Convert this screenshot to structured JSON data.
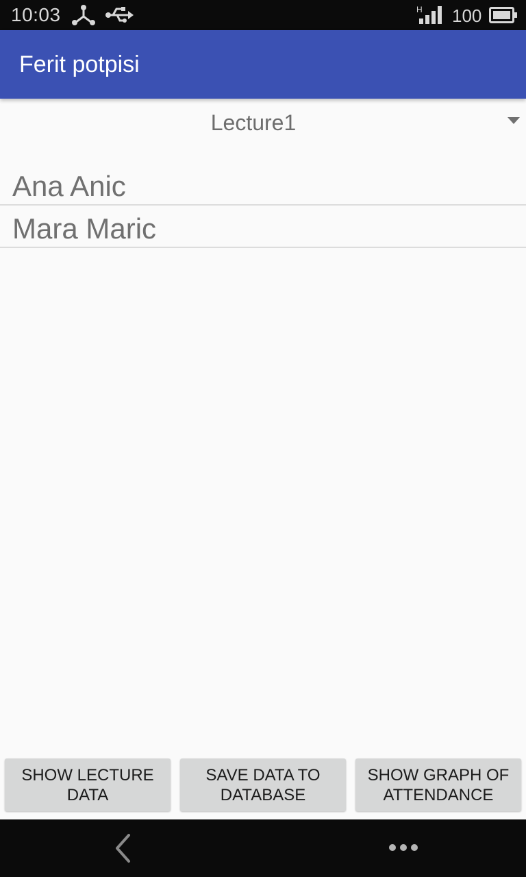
{
  "status_bar": {
    "time": "10:03",
    "network_type": "H",
    "battery_level": "100",
    "icons": [
      "share-network-icon",
      "usb-icon",
      "signal-icon",
      "battery-icon"
    ]
  },
  "app_bar": {
    "title": "Ferit potpisi",
    "color": "#3b51b3"
  },
  "lecture_selector": {
    "selected": "Lecture1"
  },
  "students": [
    {
      "name": "Ana Anic"
    },
    {
      "name": "Mara Maric"
    }
  ],
  "actions": {
    "show_lecture_data": "SHOW LECTURE\nDATA",
    "save_data": "SAVE DATA TO\nDATABASE",
    "show_graph": "SHOW GRAPH OF\nATTENDANCE"
  },
  "navigation": {
    "icons": [
      "back-icon",
      "more-icon"
    ]
  }
}
